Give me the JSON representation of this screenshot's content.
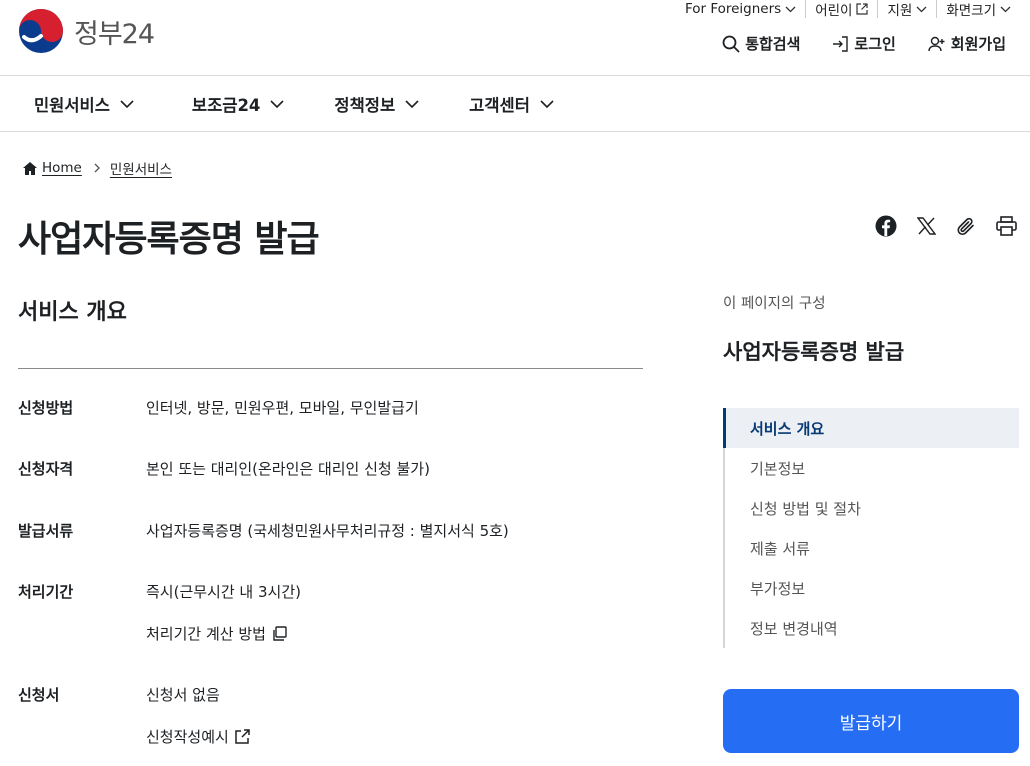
{
  "logo": {
    "text": "정부24"
  },
  "utility": [
    {
      "label": "For Foreigners",
      "icon": "chevron-down-icon"
    },
    {
      "label": "어린이",
      "icon": "external-link-icon"
    },
    {
      "label": "지원",
      "icon": "chevron-down-icon"
    },
    {
      "label": "화면크기",
      "icon": "chevron-down-icon"
    }
  ],
  "actions": {
    "search": "통합검색",
    "login": "로그인",
    "signup": "회원가입"
  },
  "gnb": [
    "민원서비스",
    "보조금24",
    "정책정보",
    "고객센터"
  ],
  "breadcrumb": {
    "home": "Home",
    "current": "민원서비스"
  },
  "page_title": "사업자등록증명 발급",
  "section_title": "서비스 개요",
  "rows": [
    {
      "label": "신청방법",
      "value": "인터넷, 방문, 민원우편, 모바일, 무인발급기"
    },
    {
      "label": "신청자격",
      "value": "본인 또는 대리인(온라인은 대리인 신청 불가)"
    },
    {
      "label": "발급서류",
      "value": "사업자등록증명 (국세청민원사무처리규정 : 별지서식 5호)"
    },
    {
      "label": "처리기간",
      "value": "즉시(근무시간 내 3시간)"
    },
    {
      "label": "신청서",
      "value": "신청서 없음"
    }
  ],
  "links": {
    "calc": "처리기간 계산 방법",
    "example": "신청작성예시"
  },
  "toc": {
    "caption": "이 페이지의 구성",
    "title": "사업자등록증명 발급",
    "items": [
      "서비스 개요",
      "기본정보",
      "신청 방법 및 절차",
      "제출 서류",
      "부가정보",
      "정보 변경내역"
    ]
  },
  "issue_button": "발급하기",
  "colors": {
    "primary": "#256ef4",
    "navy": "#063a74"
  }
}
